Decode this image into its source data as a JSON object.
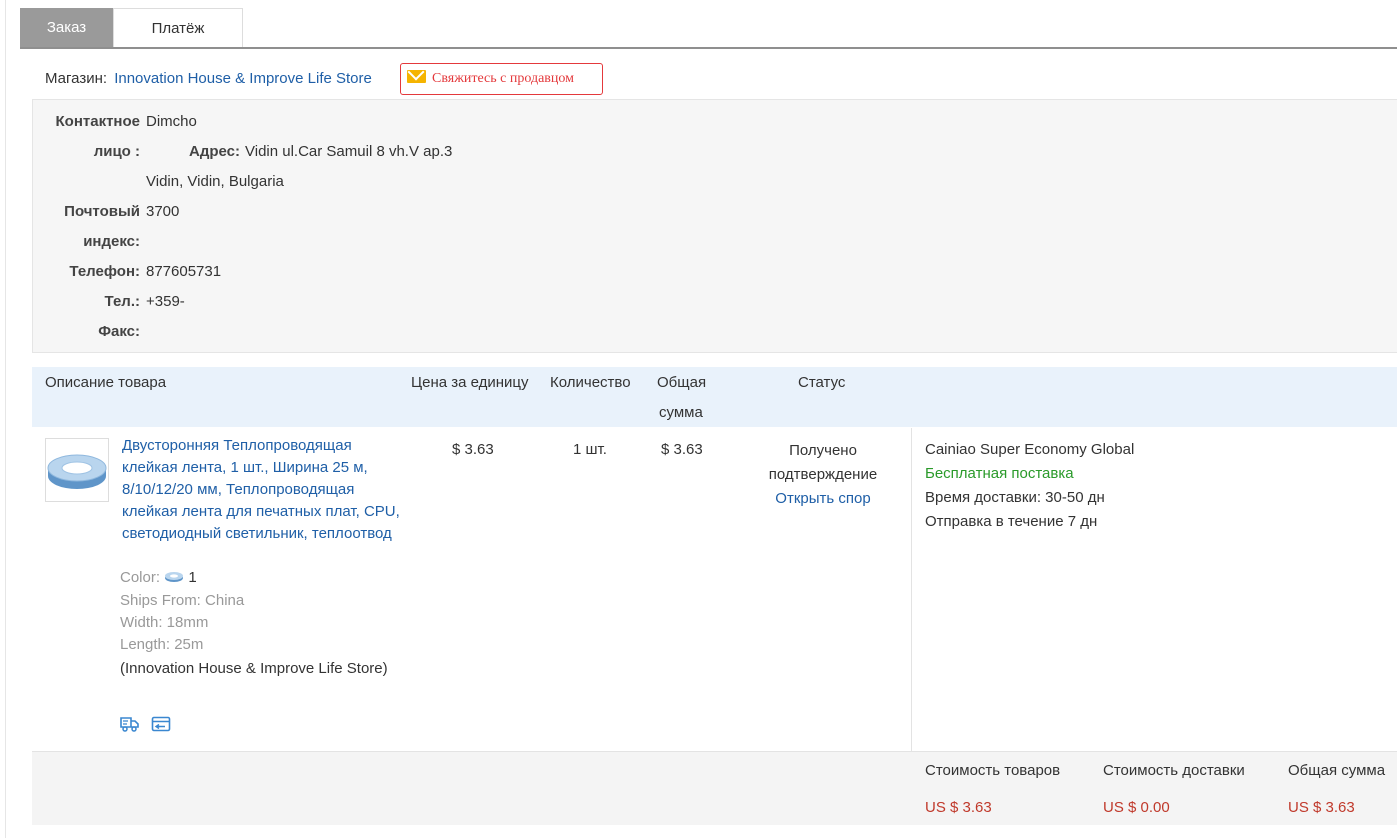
{
  "tabs": {
    "order": "Заказ",
    "payment": "Платёж"
  },
  "store": {
    "label": "Магазин:",
    "name": "Innovation House & Improve Life Store",
    "contact_button": "Свяжитесь с продавцом"
  },
  "address": {
    "contact_label_1": "Контактное",
    "contact_label_2": "лицо :",
    "contact_value": "Dimcho",
    "address_label": "Адрес:",
    "address_line_1": "Vidin ul.Car Samuil 8 vh.V ap.3",
    "address_line_2": "Vidin, Vidin, Bulgaria",
    "zip_label_1": "Почтовый",
    "zip_label_2": "индекс:",
    "zip_value": "3700",
    "phone_label": "Телефон:",
    "phone_value": "877605731",
    "tel_label": "Тел.:",
    "tel_value": "+359-",
    "fax_label": "Факс:"
  },
  "table_header": {
    "description": "Описание товара",
    "unit_price": "Цена за единицу",
    "quantity": "Количество",
    "total_1": "Общая",
    "total_2": "сумма",
    "status": "Статус"
  },
  "product": {
    "title": "Двусторонняя Теплопроводящая клейкая лента, 1 шт., Ширина 25 м, 8/10/12/20 мм, Теплопроводящая клейкая лента для печатных плат, CPU, светодиодный светильник, теплоотвод",
    "color_label": "Color:",
    "color_value": "1",
    "ships_from": "Ships From: China",
    "width": "Width: 18mm",
    "length": "Length: 25m",
    "store_note": "(Innovation House & Improve Life Store)",
    "unit_price": "$ 3.63",
    "quantity": "1 шт.",
    "total": "$ 3.63",
    "status_1": "Получено",
    "status_2": "подтверждение",
    "dispute_link": "Открыть спор",
    "icons": [
      "delivery-truck-icon",
      "return-card-icon"
    ]
  },
  "shipping": {
    "method": "Cainiao Super Economy Global",
    "free": "Бесплатная поставка",
    "delivery_time": "Время доставки: 30-50 дн",
    "dispatch": "Отправка в течение 7 дн"
  },
  "totals": {
    "goods_label": "Стоимость товаров",
    "goods_value": "US $ 3.63",
    "shipping_label": "Стоимость доставки",
    "shipping_value": "US $ 0.00",
    "total_label": "Общая сумма",
    "total_value": "US $ 3.63"
  },
  "colors": {
    "link": "#1f5fa7",
    "accent_red": "#e4393c",
    "price_red": "#c0392b",
    "free_green": "#2a9a2a",
    "header_bg": "#e9f2fb"
  }
}
